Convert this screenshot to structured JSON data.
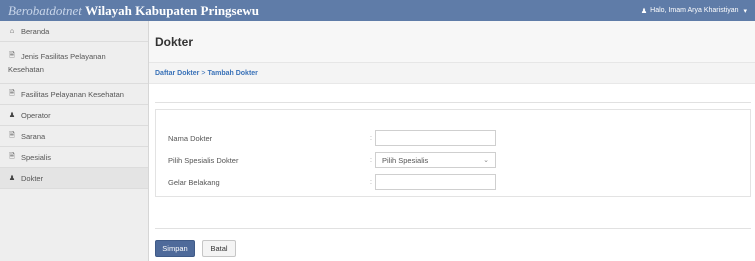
{
  "topbar": {
    "brand_italic": "Berobatdotnet",
    "brand_bold": "Wilayah Kabupaten Pringsewu",
    "user_label": "Halo, Imam Arya Kharistiyan"
  },
  "sidebar": {
    "items": [
      {
        "label": "Beranda",
        "icon": "home-icon"
      },
      {
        "label": "Jenis Fasilitas Pelayanan",
        "label_cont": "Kesehatan",
        "icon": "file-icon"
      },
      {
        "label": "Fasilitas Pelayanan Kesehatan",
        "icon": "file-icon"
      },
      {
        "label": "Operator",
        "icon": "user-icon"
      },
      {
        "label": "Sarana",
        "icon": "file-icon"
      },
      {
        "label": "Spesialis",
        "icon": "file-icon"
      },
      {
        "label": "Dokter",
        "icon": "user-icon"
      }
    ]
  },
  "main": {
    "title": "Dokter",
    "breadcrumb": {
      "link": "Daftar Dokter",
      "separator": ">",
      "current": "Tambah Dokter"
    },
    "form": {
      "nama_label": "Nama Dokter",
      "nama_value": "",
      "spesialis_label": "Pilih Spesialis Dokter",
      "spesialis_selected": "Pilih Spesialis",
      "gelar_label": "Gelar Belakang",
      "gelar_value": "",
      "colon": ":"
    },
    "buttons": {
      "save": "Simpan",
      "cancel": "Batal"
    }
  },
  "colors": {
    "topbar": "#5f7ca8",
    "link": "#3a72b8",
    "primary_button": "#4e6a9a"
  }
}
